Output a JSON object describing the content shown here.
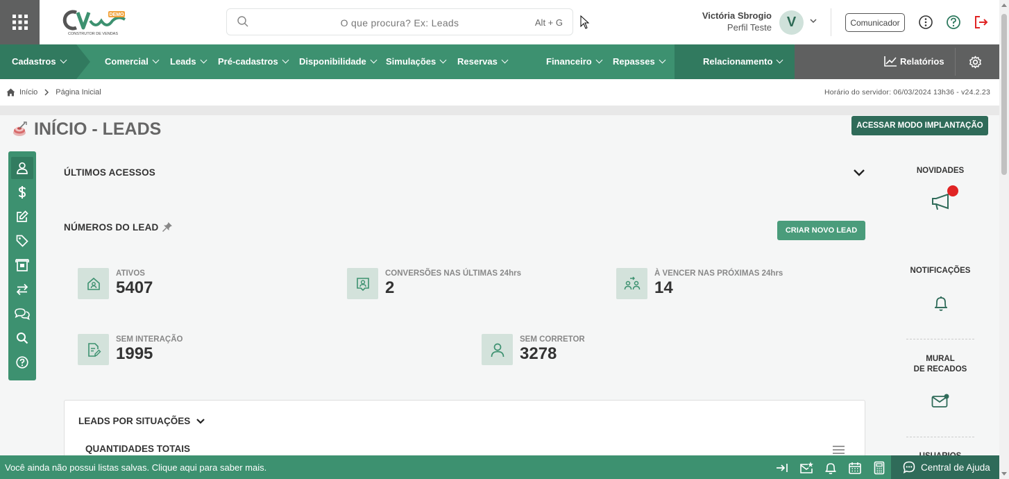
{
  "header": {
    "logo_text": "CV",
    "logo_badge": "DEMO",
    "logo_sub": "CONSTRUTOR DE VENDAS",
    "search_placeholder": "O que procura? Ex: Leads",
    "search_shortcut": "Alt + G",
    "user_name": "Victória Sbrogio",
    "user_profile": "Perfil Teste",
    "avatar_letter": "V",
    "comunicador_label": "Comunicador"
  },
  "nav": {
    "items": [
      "Cadastros",
      "Comercial",
      "Leads",
      "Pré-cadastros",
      "Disponibilidade",
      "Simulações",
      "Reservas",
      "Financeiro",
      "Repasses",
      "Relacionamento"
    ],
    "reports_label": "Relatórios"
  },
  "breadcrumb": {
    "home": "Início",
    "current": "Página Inicial",
    "server_time": "Horário do servidor: 06/03/2024 13h36 - v24.2.23"
  },
  "page": {
    "title": "INÍCIO - LEADS",
    "implant_button": "ACESSAR MODO IMPLANTAÇÃO"
  },
  "main": {
    "last_access_title": "ÚLTIMOS ACESSOS",
    "lead_numbers_title": "NÚMEROS DO LEAD",
    "create_lead_button": "CRIAR NOVO LEAD",
    "stats": [
      {
        "label": "ATIVOS",
        "value": "5407"
      },
      {
        "label": "CONVERSÕES NAS ÚLTIMAS 24hrs",
        "value": "2"
      },
      {
        "label": "À VENCER NAS PRÓXIMAS 24hrs",
        "value": "14"
      },
      {
        "label": "SEM INTERAÇÃO",
        "value": "1995"
      },
      {
        "label": "SEM CORRETOR",
        "value": "3278"
      }
    ],
    "leads_by_status_title": "LEADS POR SITUAÇÕES",
    "totals_title": "QUANTIDADES TOTAIS"
  },
  "right": {
    "news": "NOVIDADES",
    "notifications": "NOTIFICAÇÕES",
    "mural_line1": "MURAL",
    "mural_line2": "DE RECADOS",
    "users_partial": "USUÁRIOS"
  },
  "bottom": {
    "message": "Você ainda não possui listas salvas. Clique aqui para saber mais.",
    "help_label": "Central de Ajuda"
  },
  "colors": {
    "brand_green": "#3d9170",
    "dark_green": "#2f6b59",
    "gray": "#5f6060",
    "alert_red": "#e02424"
  }
}
